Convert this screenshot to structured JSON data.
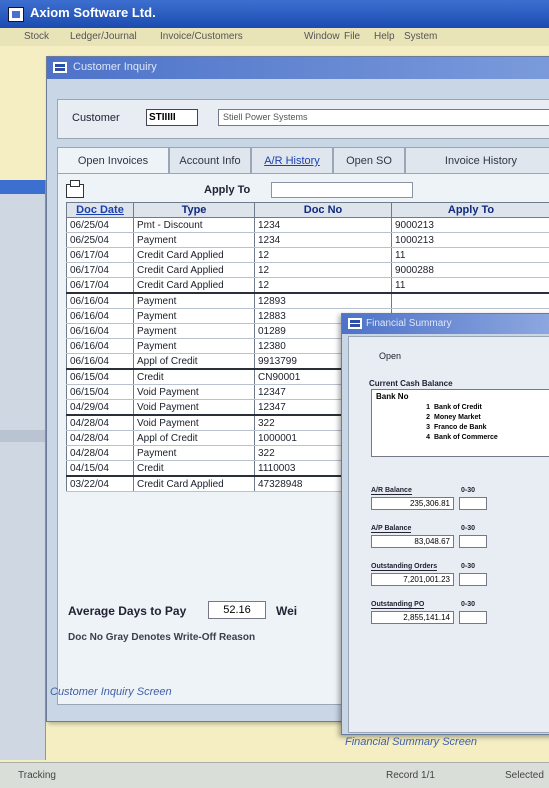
{
  "app": {
    "title": "Axiom Software Ltd."
  },
  "menu": [
    {
      "label": "Stock"
    },
    {
      "label": "Ledger/Journal"
    },
    {
      "label": "Invoice/Customers"
    },
    {
      "label": "Window"
    },
    {
      "label": "File"
    },
    {
      "label": "Help"
    },
    {
      "label": "System"
    }
  ],
  "customer_inquiry": {
    "title": "Customer Inquiry",
    "customer_label": "Customer",
    "customer_code": "STIIIII",
    "customer_name": "Stiell Power Systems",
    "tabs": [
      {
        "label": "Open Invoices"
      },
      {
        "label": "Account Info"
      },
      {
        "label": "A/R History"
      },
      {
        "label": "Open SO"
      },
      {
        "label": "Invoice History"
      }
    ],
    "apply_to_label": "Apply To",
    "columns": [
      "Doc Date",
      "Type",
      "Doc No",
      "Apply To"
    ],
    "rows": [
      {
        "date": "06/25/04",
        "type": "Pmt - Discount",
        "doc": "1234",
        "apply": "9000213"
      },
      {
        "date": "06/25/04",
        "type": "Payment",
        "doc": "1234",
        "apply": "1000213"
      },
      {
        "date": "06/17/04",
        "type": "Credit Card Applied",
        "doc": "12",
        "apply": "11"
      },
      {
        "date": "06/17/04",
        "type": "Credit Card Applied",
        "doc": "12",
        "apply": "9000288"
      },
      {
        "date": "06/17/04",
        "type": "Credit Card Applied",
        "doc": "12",
        "apply": "11"
      },
      {
        "date": "06/16/04",
        "type": "Payment",
        "doc": "12893",
        "apply": ""
      },
      {
        "date": "06/16/04",
        "type": "Payment",
        "doc": "12883",
        "apply": ""
      },
      {
        "date": "06/16/04",
        "type": "Payment",
        "doc": "01289",
        "apply": ""
      },
      {
        "date": "06/16/04",
        "type": "Payment",
        "doc": "12380",
        "apply": ""
      },
      {
        "date": "06/16/04",
        "type": "Appl of Credit",
        "doc": "9913799",
        "apply": ""
      },
      {
        "date": "06/15/04",
        "type": "Credit",
        "doc": "CN90001",
        "apply": ""
      },
      {
        "date": "06/15/04",
        "type": "Void Payment",
        "doc": "12347",
        "apply": ""
      },
      {
        "date": "04/29/04",
        "type": "Void Payment",
        "doc": "12347",
        "apply": ""
      },
      {
        "date": "04/28/04",
        "type": "Void Payment",
        "doc": "322",
        "apply": ""
      },
      {
        "date": "04/28/04",
        "type": "Appl of Credit",
        "doc": "1000001",
        "apply": ""
      },
      {
        "date": "04/28/04",
        "type": "Payment",
        "doc": "322",
        "apply": ""
      },
      {
        "date": "04/15/04",
        "type": "Credit",
        "doc": "1110003",
        "apply": ""
      },
      {
        "date": "03/22/04",
        "type": "Credit Card Applied",
        "doc": "47328948",
        "apply": ""
      }
    ],
    "avg_days_label": "Average Days to Pay",
    "avg_days_value": "52.16",
    "weighted_label": "Wei",
    "legend": "Doc No Gray Denotes Write-Off Reason"
  },
  "financial_summary": {
    "title": "Financial Summary",
    "open_label": "Open",
    "ccb_label": "Current Cash Balance",
    "bank_no_label": "Bank No",
    "banks": [
      {
        "no": "1",
        "name": "Bank of Credit"
      },
      {
        "no": "2",
        "name": "Money Market"
      },
      {
        "no": "3",
        "name": "Franco de Bank"
      },
      {
        "no": "4",
        "name": "Bank of Commerce"
      }
    ],
    "ar_balance_label": "A/R Balance",
    "ar_balance_value": "235,306.81",
    "ap_balance_label": "A/P Balance",
    "ap_balance_value": "83,048.67",
    "outstanding_orders_label": "Outstanding Orders",
    "outstanding_orders_value": "7,201,001.23",
    "outstanding_po_label": "Outstanding PO",
    "outstanding_po_value": "2,855,141.14",
    "mini_label": "0-30"
  },
  "captions": {
    "customer": "Customer Inquiry Screen",
    "financial": "Financial Summary Screen"
  },
  "status": {
    "left": "Tracking",
    "mid": "Record 1/1",
    "right": "Selected"
  }
}
